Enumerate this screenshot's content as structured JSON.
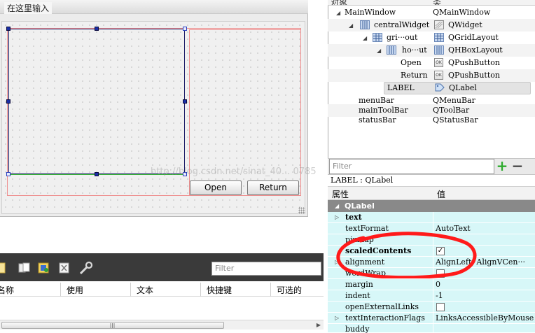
{
  "designer": {
    "type_here_text": "在这里输入",
    "buttons": {
      "open": "Open",
      "return": "Return"
    }
  },
  "action_editor": {
    "filter_placeholder": "Filter",
    "columns": [
      "名称",
      "使用",
      "文本",
      "快捷键",
      "可选的"
    ],
    "toolbar_icons": [
      "new-action-icon",
      "copy-icon",
      "properties-icon",
      "delete-icon",
      "configure-icon"
    ]
  },
  "object_inspector": {
    "headers": {
      "object": "对象",
      "class": "类"
    },
    "tree": [
      {
        "name": "MainWindow",
        "class": "QMainWindow",
        "icon": "main-window-icon"
      },
      {
        "name": "centralWidget",
        "class": "QWidget",
        "icon": "widget-icon"
      },
      {
        "name": "gri···out",
        "class": "QGridLayout",
        "icon": "grid-layout-icon"
      },
      {
        "name": "ho···ut",
        "class": "QHBoxLayout",
        "icon": "hbox-layout-icon"
      },
      {
        "name": "Open",
        "class": "QPushButton",
        "icon": "push-button-icon"
      },
      {
        "name": "Return",
        "class": "QPushButton",
        "icon": "push-button-icon"
      },
      {
        "name": "LABEL",
        "class": "QLabel",
        "icon": "label-icon"
      },
      {
        "name": "menuBar",
        "class": "QMenuBar"
      },
      {
        "name": "mainToolBar",
        "class": "QToolBar"
      },
      {
        "name": "statusBar",
        "class": "QStatusBar"
      }
    ],
    "filter_placeholder": "Filter"
  },
  "property_editor": {
    "title": "LABEL : QLabel",
    "headers": {
      "property": "属性",
      "value": "值"
    },
    "group": "QLabel",
    "rows": [
      {
        "name": "text",
        "value": ""
      },
      {
        "name": "textFormat",
        "value": "AutoText"
      },
      {
        "name": "pixmap",
        "value": ""
      },
      {
        "name": "scaledContents",
        "value": "✓"
      },
      {
        "name": "alignment",
        "value": "AlignLeft, AlignVCen···"
      },
      {
        "name": "wordWrap",
        "value": ""
      },
      {
        "name": "margin",
        "value": "0"
      },
      {
        "name": "indent",
        "value": "-1"
      },
      {
        "name": "openExternalLinks",
        "value": ""
      },
      {
        "name": "textInteractionFlags",
        "value": "LinksAccessibleByMouse"
      },
      {
        "name": "buddy",
        "value": ""
      }
    ]
  },
  "watermark": "http://blog.csdn.net/sinat_40... 0785",
  "colors": {
    "selection_red": "#ee8f8f",
    "grid_border": "#1a1a66",
    "property_bg": "#d7f7f8",
    "annotation_red": "#ff1a1a"
  }
}
